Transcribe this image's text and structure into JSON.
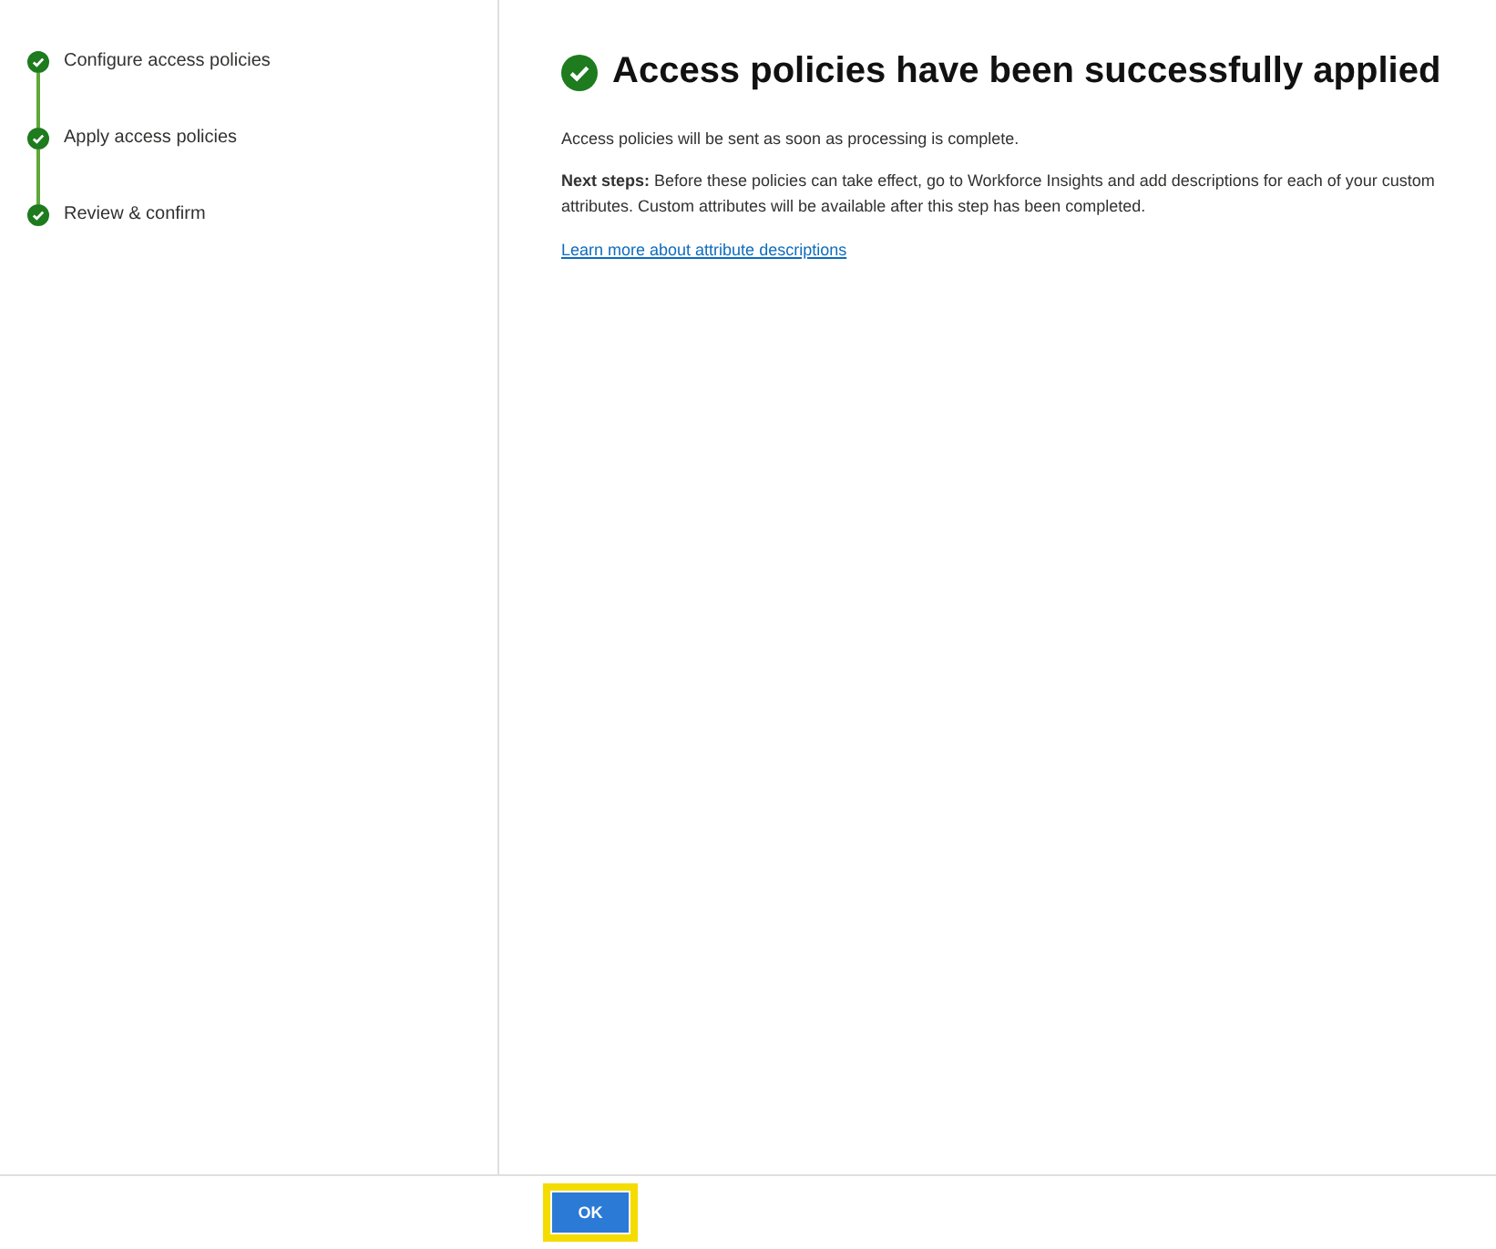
{
  "steps": [
    {
      "label": "Configure access policies",
      "completed": true
    },
    {
      "label": "Apply access policies",
      "completed": true
    },
    {
      "label": "Review & confirm",
      "completed": true
    }
  ],
  "content": {
    "title": "Access policies have been successfully applied",
    "status_text": "Access policies will be sent as soon as processing is complete.",
    "next_steps": "**Next steps:** Before these policies can take effect, go to Workforce Insights and add descriptions for each of your custom attributes. Custom attributes will be available after this step has been completed.",
    "link": "Learn more about attribute descriptions"
  },
  "footer": {
    "ok_button": {
      "label": "OK",
      "focused": true
    }
  }
}
